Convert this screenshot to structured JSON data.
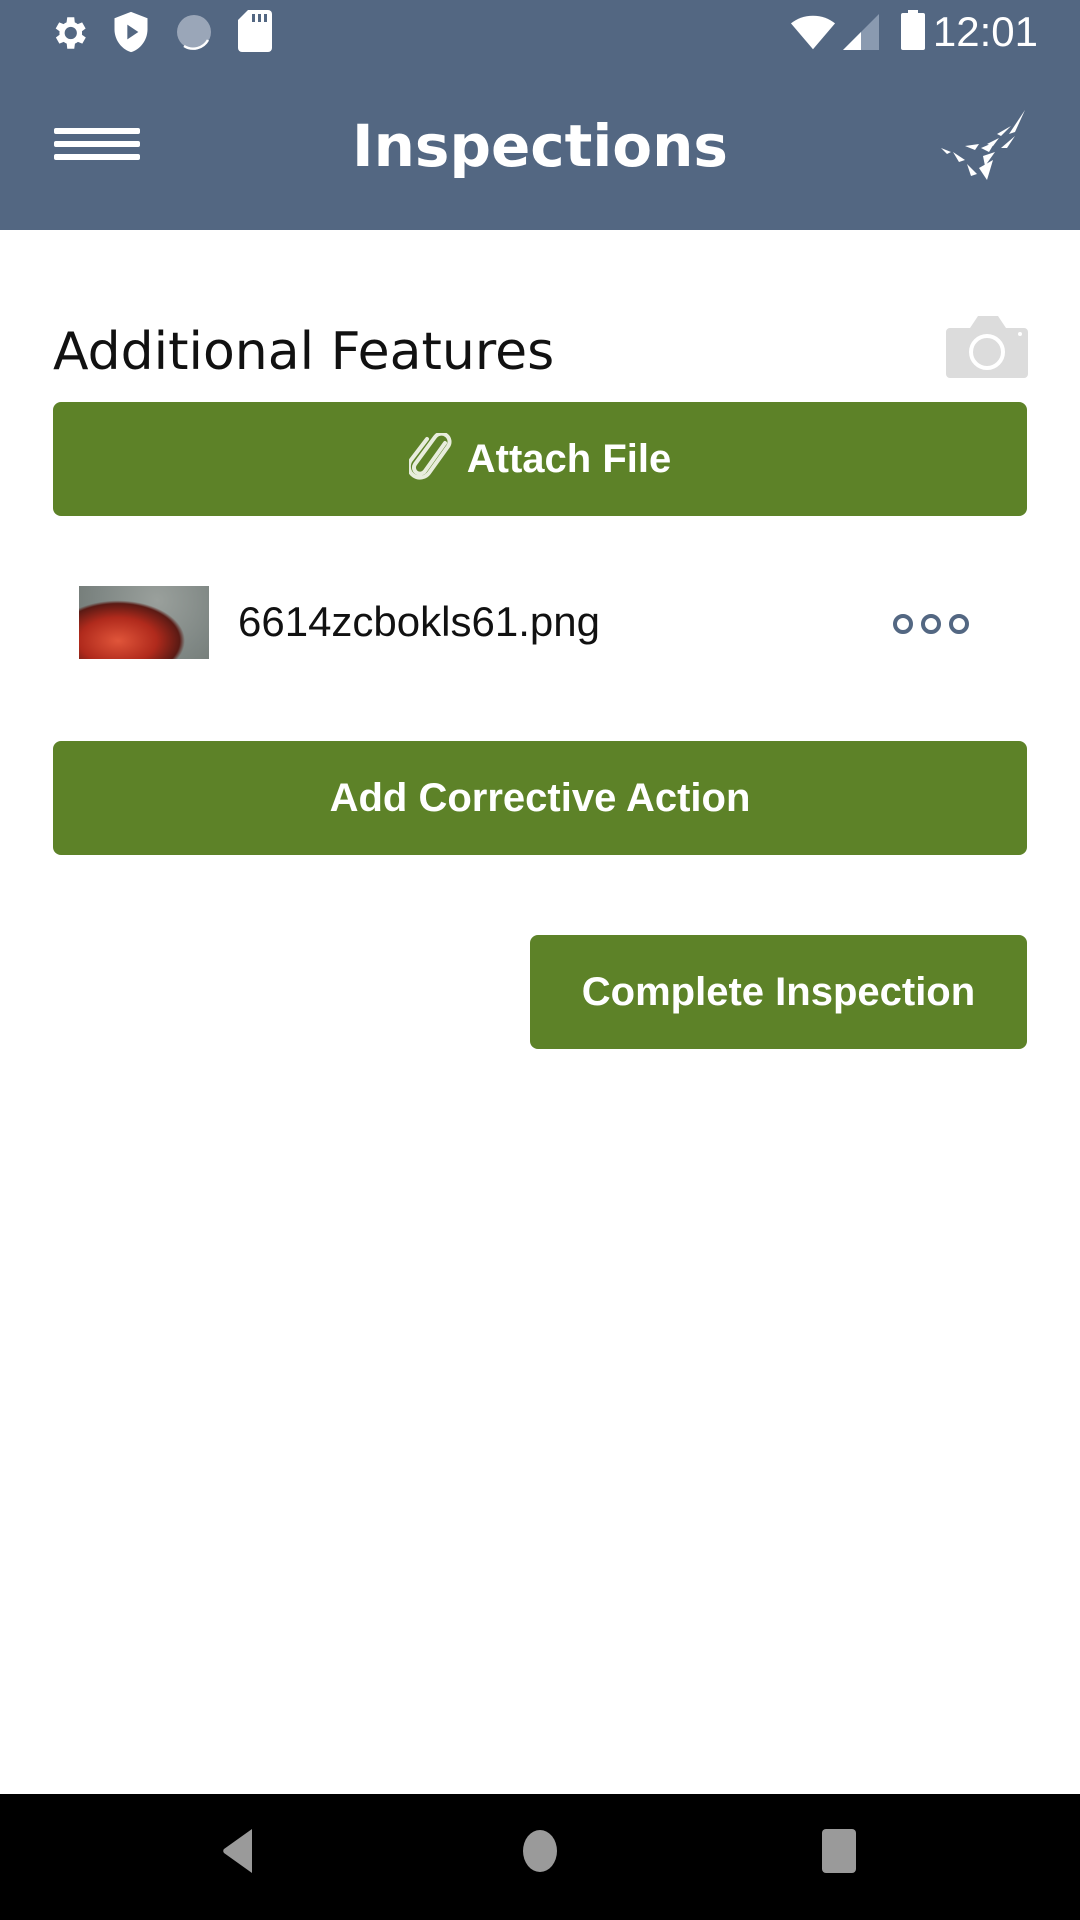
{
  "status_bar": {
    "time": "12:01",
    "left_icons": [
      "settings-icon",
      "shield-play-icon",
      "sync-progress-icon",
      "sd-card-icon"
    ],
    "right_icons": [
      "wifi-icon",
      "cell-signal-icon",
      "battery-icon"
    ]
  },
  "header": {
    "title": "Inspections",
    "menu_icon": "hamburger-menu-icon",
    "logo_icon": "brand-logo-icon"
  },
  "section": {
    "title": "Additional Features",
    "camera_icon": "camera-icon"
  },
  "buttons": {
    "attach_file": "Attach File",
    "add_corrective_action": "Add Corrective Action",
    "complete_inspection": "Complete Inspection"
  },
  "attachments": [
    {
      "file_name": "6614zcbokls61.png",
      "menu_icon": "more-options-icon"
    }
  ],
  "colors": {
    "header": "#536782",
    "button_green": "#5d8228",
    "nav_bar": "#000000"
  },
  "nav_bar": {
    "buttons": [
      "back",
      "home",
      "recents"
    ]
  }
}
